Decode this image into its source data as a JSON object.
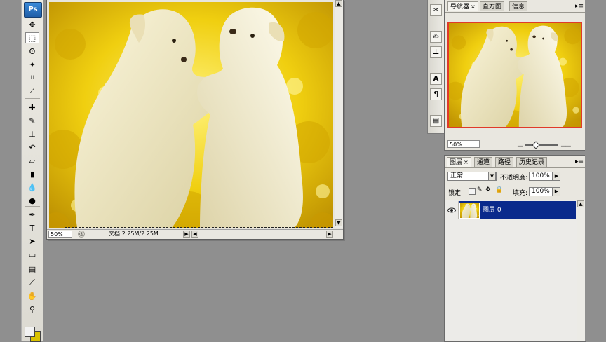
{
  "app": {
    "logo_text": "Ps"
  },
  "toolbox": {
    "tools": [
      {
        "name": "move-tool-icon",
        "glyph": "✥"
      },
      {
        "name": "rect-marquee-tool-icon",
        "glyph": "⬚",
        "selected": true
      },
      {
        "name": "lasso-tool-icon",
        "glyph": "ʘ"
      },
      {
        "name": "magic-wand-tool-icon",
        "glyph": "✦"
      },
      {
        "name": "crop-tool-icon",
        "glyph": "⌗"
      },
      {
        "name": "slice-tool-icon",
        "glyph": "⟋"
      },
      {
        "name": "healing-brush-tool-icon",
        "glyph": "✚"
      },
      {
        "name": "brush-tool-icon",
        "glyph": "✎"
      },
      {
        "name": "clone-stamp-tool-icon",
        "glyph": "⊥"
      },
      {
        "name": "history-brush-tool-icon",
        "glyph": "↶"
      },
      {
        "name": "eraser-tool-icon",
        "glyph": "▱"
      },
      {
        "name": "gradient-tool-icon",
        "glyph": "▮"
      },
      {
        "name": "blur-tool-icon",
        "glyph": "💧"
      },
      {
        "name": "dodge-tool-icon",
        "glyph": "●"
      },
      {
        "name": "pen-tool-icon",
        "glyph": "✒"
      },
      {
        "name": "type-tool-icon",
        "glyph": "T"
      },
      {
        "name": "path-select-tool-icon",
        "glyph": "➤"
      },
      {
        "name": "shape-tool-icon",
        "glyph": "▭"
      },
      {
        "name": "notes-tool-icon",
        "glyph": "▤"
      },
      {
        "name": "eyedropper-tool-icon",
        "glyph": "⟋"
      },
      {
        "name": "hand-tool-icon",
        "glyph": "✋"
      },
      {
        "name": "zoom-tool-icon",
        "glyph": "⚲"
      }
    ]
  },
  "document": {
    "zoom": "50%",
    "info": "文档:2.25M/2.25M"
  },
  "navigator_panel": {
    "tabs": [
      "导航器",
      "直方图",
      "信息"
    ],
    "zoom": "50%"
  },
  "layers_panel": {
    "tabs": [
      "图层",
      "通道",
      "路径",
      "历史记录"
    ],
    "blend_mode": "正常",
    "opacity_label": "不透明度:",
    "opacity_value": "100%",
    "lock_label": "锁定:",
    "fill_label": "填充:",
    "fill_value": "100%",
    "layers": [
      {
        "name": "图层 0",
        "selected": true
      }
    ]
  },
  "colors": {
    "selection_blue": "#0a2a8c",
    "navigator_frame": "#e03a2a",
    "photo_yellow": "#e9c400"
  }
}
